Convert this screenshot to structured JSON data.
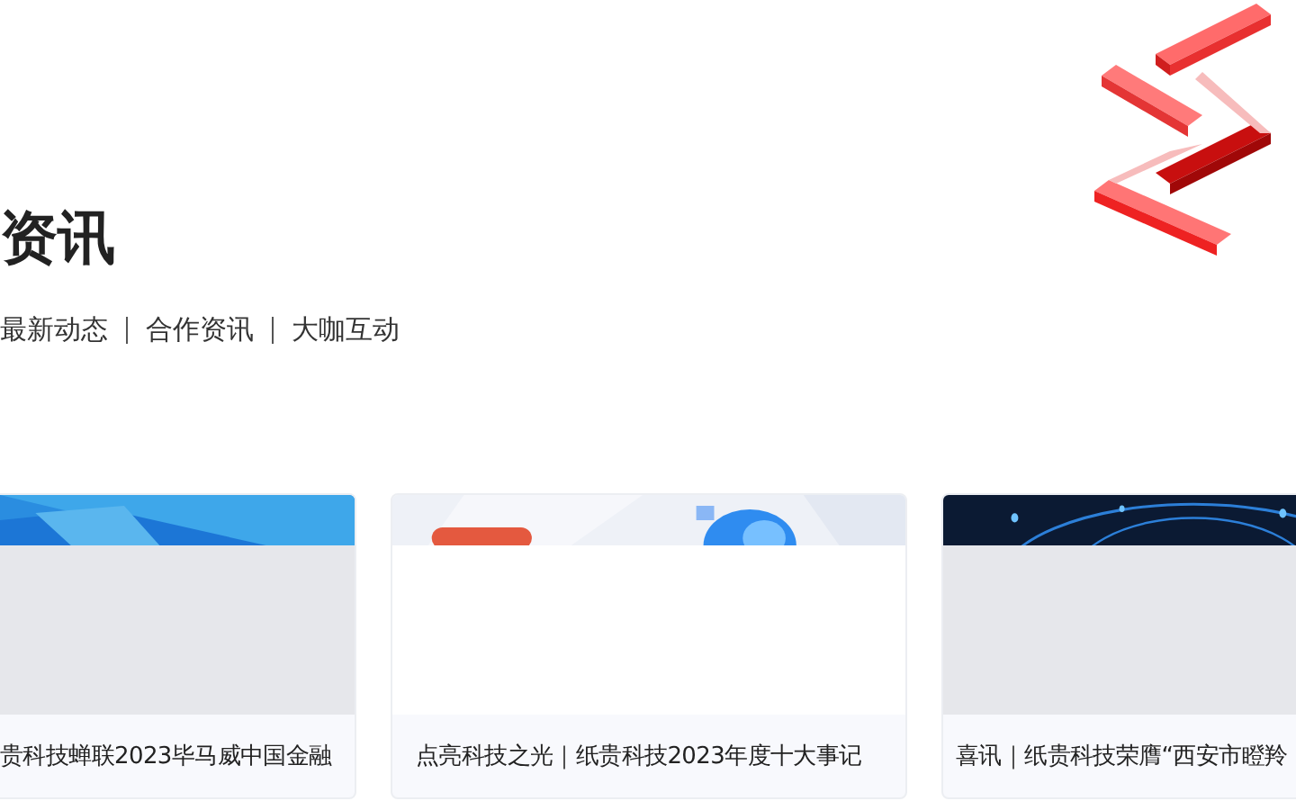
{
  "section": {
    "title": "资讯"
  },
  "tabs": [
    {
      "label": "最新动态"
    },
    {
      "label": "合作资讯"
    },
    {
      "label": "大咖互动"
    }
  ],
  "cards": [
    {
      "kind": "cropped",
      "title": "贵科技蝉联2023毕马威中国金融"
    },
    {
      "kind": "full",
      "title": "点亮科技之光｜纸贵科技2023年度十大事记"
    },
    {
      "kind": "full",
      "title": "喜讯｜纸贵科技荣膺“西安市瞪羚"
    }
  ]
}
